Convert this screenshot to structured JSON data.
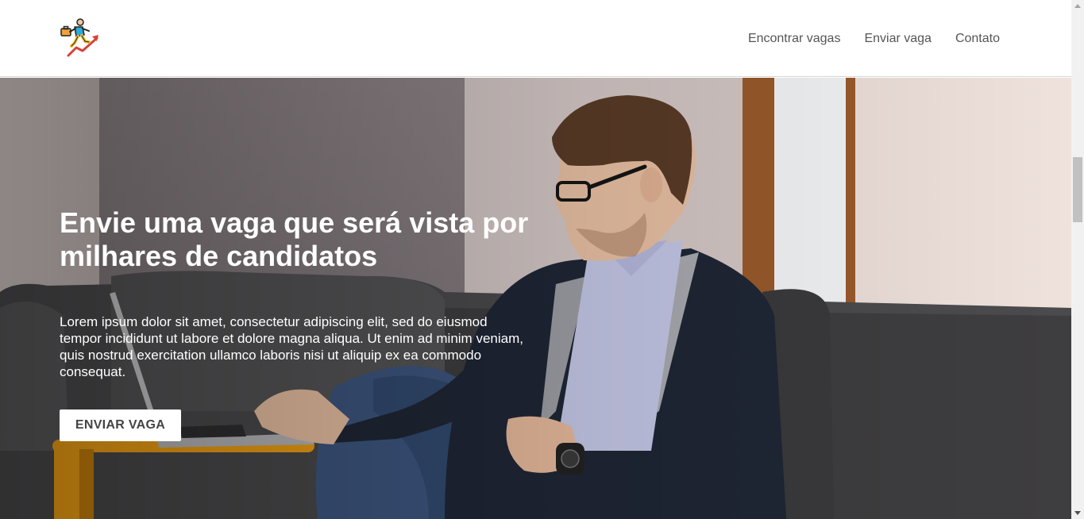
{
  "header": {
    "logo_icon": "climbing-chart-man-icon",
    "nav": [
      {
        "label": "Encontrar vagas"
      },
      {
        "label": "Enviar vaga"
      },
      {
        "label": "Contato"
      }
    ]
  },
  "hero": {
    "title": "Envie uma vaga que será vista por milhares de candidatos",
    "text": "Lorem ipsum dolor sit amet, consectetur adipiscing elit, sed do eiusmod tempor incididunt ut labore et dolore magna aliqua. Ut enim ad minim veniam, quis nostrud exercitation ullamco laboris nisi ut aliquip ex ea commodo consequat.",
    "button_label": "ENVIAR VAGA",
    "background_image": "man-with-laptop-on-sofa-photo"
  },
  "colors": {
    "nav_text": "#555555",
    "button_text": "#444444",
    "hero_text": "#ffffff"
  }
}
